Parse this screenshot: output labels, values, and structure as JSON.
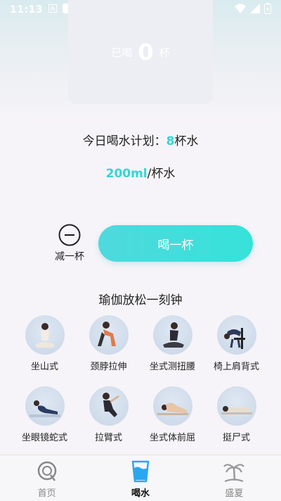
{
  "status_bar": {
    "time": "11:13"
  },
  "cup_card": {
    "prefix": "已喝",
    "count": "0",
    "suffix": "杯"
  },
  "plan": {
    "label": "今日喝水计划：",
    "cups": "8",
    "unit": "杯水"
  },
  "volume": {
    "amount": "200ml",
    "unit": "/杯水"
  },
  "actions": {
    "minus_label": "减一杯",
    "drink_label": "喝一杯"
  },
  "yoga": {
    "title": "瑜伽放松一刻钟",
    "poses": [
      {
        "label": "坐山式",
        "icon": "yoga-pose-sitting-icon"
      },
      {
        "label": "颈脖拉伸",
        "icon": "yoga-pose-neck-stretch-icon"
      },
      {
        "label": "坐式测扭腰",
        "icon": "yoga-pose-seated-twist-icon"
      },
      {
        "label": "椅上肩背式",
        "icon": "yoga-pose-chair-backbend-icon"
      },
      {
        "label": "坐眼镜蛇式",
        "icon": "yoga-pose-cobra-icon"
      },
      {
        "label": "拉臂式",
        "icon": "yoga-pose-arm-stretch-icon"
      },
      {
        "label": "坐式体前屈",
        "icon": "yoga-pose-forward-bend-icon"
      },
      {
        "label": "挺尸式",
        "icon": "yoga-pose-corpse-icon"
      }
    ]
  },
  "nav": {
    "items": [
      {
        "label": "首页",
        "icon": "home-icon",
        "active": false
      },
      {
        "label": "喝水",
        "icon": "water-cup-icon",
        "active": true
      },
      {
        "label": "盛夏",
        "icon": "palm-tree-icon",
        "active": false
      }
    ]
  },
  "colors": {
    "accent": "#33d6d6",
    "button": "#3ee0d9",
    "background": "#f6f4f8"
  }
}
